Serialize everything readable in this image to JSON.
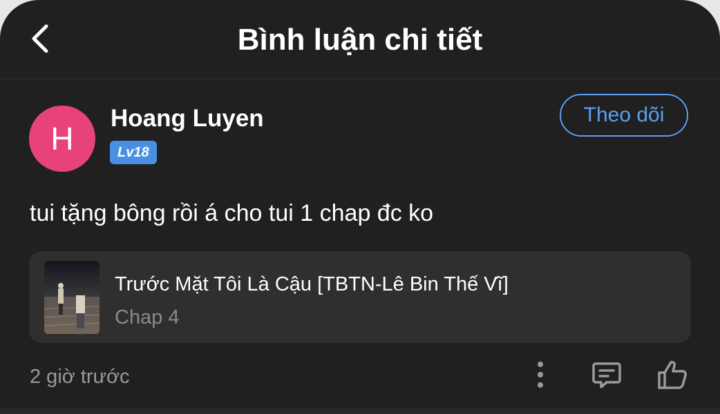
{
  "header": {
    "title": "Bình luận chi tiết",
    "back_icon": "chevron-left-icon"
  },
  "comment": {
    "author": {
      "avatar_letter": "H",
      "avatar_color": "#e8427c",
      "name": "Hoang Luyen",
      "level": "Lv18"
    },
    "follow_label": "Theo dõi",
    "text": "tui tặng bông rồi á cho tui 1 chap đc ko",
    "linked_item": {
      "title": "Trước Mặt Tôi Là Cậu [TBTN-Lê Bin Thế Vĩ]",
      "subtitle": "Chap 4"
    },
    "timestamp": "2 giờ trước",
    "actions": [
      "more-vertical-icon",
      "comment-icon",
      "thumbs-up-icon"
    ]
  },
  "colors": {
    "accent": "#5aa0f0",
    "level_badge": "#4a90e2",
    "background": "#202020",
    "card": "#2f2f2f"
  }
}
